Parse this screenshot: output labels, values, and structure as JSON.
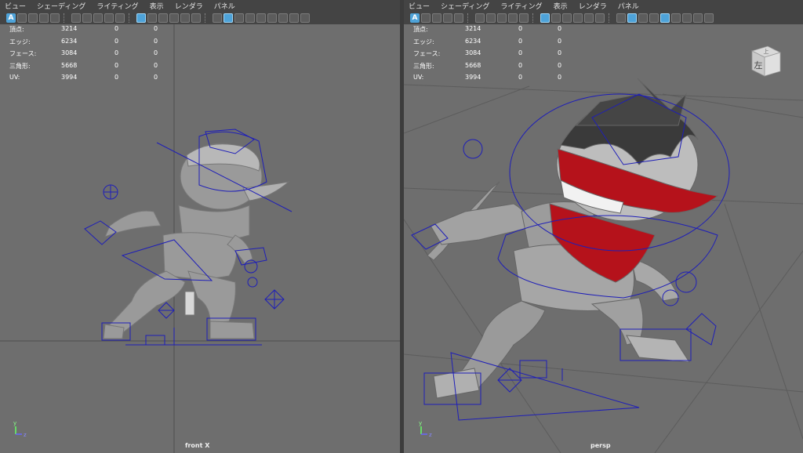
{
  "left_panel": {
    "menu": [
      "ビュー",
      "シェーディング",
      "ライティング",
      "表示",
      "レンダラ",
      "パネル"
    ],
    "camera_label": "front X"
  },
  "right_panel": {
    "menu": [
      "ビュー",
      "シェーディング",
      "ライティング",
      "表示",
      "レンダラ",
      "パネル"
    ],
    "camera_label": "persp",
    "viewcube_label": "左",
    "viewcube_top_label": "上"
  },
  "hud": {
    "rows": [
      {
        "label": "頂点:",
        "v1": "3214",
        "v2": "0",
        "v3": "0"
      },
      {
        "label": "エッジ:",
        "v1": "6234",
        "v2": "0",
        "v3": "0"
      },
      {
        "label": "フェース:",
        "v1": "3084",
        "v2": "0",
        "v3": "0"
      },
      {
        "label": "三角形:",
        "v1": "5668",
        "v2": "0",
        "v3": "0"
      },
      {
        "label": "UV:",
        "v1": "3994",
        "v2": "0",
        "v3": "0"
      }
    ]
  },
  "toolbar": {
    "selection_mode_label": "A",
    "icons": [
      "select-camera-icon",
      "camera-attributes-icon",
      "bookmark-icon",
      "image-plane-icon",
      "2d-pan-icon",
      "grease-pencil-icon",
      "film-gate-icon",
      "resolution-gate-icon",
      "gate-mask-icon",
      "field-chart-icon",
      "safe-action-icon",
      "grid-icon",
      "wireframe-icon",
      "smooth-shade-icon",
      "lighting-icon",
      "textured-icon",
      "lights-icon",
      "shadows-icon",
      "xray-icon",
      "isolate-icon"
    ]
  },
  "axis": {
    "y": "y",
    "z": "z"
  },
  "colors": {
    "viewport_bg": "#6e6e6e",
    "menubar_bg": "#444444",
    "rig_curves": "#1a1aa8",
    "mask_red": "#b5121b",
    "accent_blue": "#4ea3d9"
  }
}
